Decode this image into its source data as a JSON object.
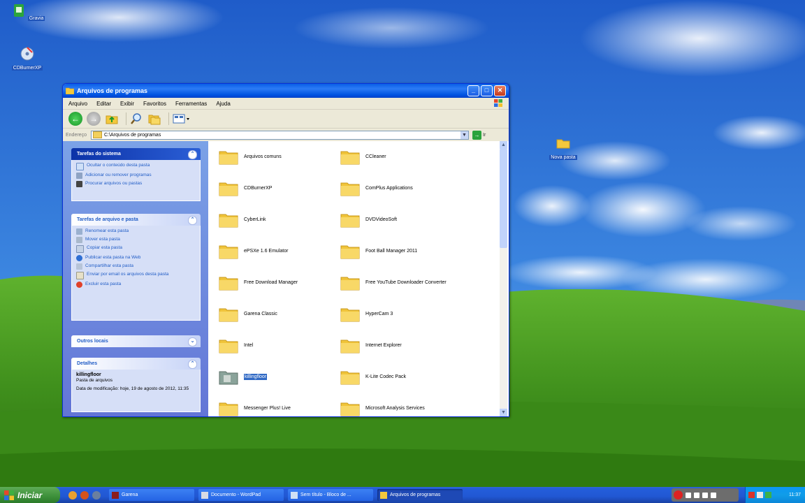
{
  "desktop": {
    "icons": [
      {
        "label": "Gravia",
        "icon": "green-app-icon"
      },
      {
        "label": "CDBurnerXP",
        "icon": "cd-burner-icon"
      },
      {
        "label": "Nova pasta",
        "icon": "folder-icon"
      }
    ]
  },
  "window": {
    "title": "Arquivos de programas",
    "menu": [
      "Arquivo",
      "Editar",
      "Exibir",
      "Favoritos",
      "Ferramentas",
      "Ajuda"
    ],
    "address": {
      "label": "Endereço",
      "value": "C:\\Arquivos de programas",
      "go_label": "Ir"
    },
    "system_tasks": {
      "title": "Tarefas do sistema",
      "items": [
        "Ocultar o conteúdo desta pasta",
        "Adicionar ou remover programas",
        "Procurar arquivos ou pastas"
      ]
    },
    "file_tasks": {
      "title": "Tarefas de arquivo e pasta",
      "items": [
        "Renomear esta pasta",
        "Mover esta pasta",
        "Copiar esta pasta",
        "Publicar esta pasta na Web",
        "Compartilhar esta pasta",
        "Enviar por email os arquivos desta pasta",
        "Excluir esta pasta"
      ]
    },
    "other_places": {
      "title": "Outros locais"
    },
    "details": {
      "title": "Detalhes",
      "name": "killingfloor",
      "type": "Pasta de arquivos",
      "modified": "Data de modificação: hoje, 19 de agosto de 2012, 11:35"
    },
    "folders": [
      "Arquivos comuns",
      "CCleaner",
      "CDBurnerXP",
      "ComPlus Applications",
      "CyberLink",
      "DVDVideoSoft",
      "ePSXe 1.6 Emulator",
      "Foot Ball Manager 2011",
      "Free Download Manager",
      "Free YouTube Downloader Converter",
      "Garena Classic",
      "HyperCam 3",
      "Intel",
      "Internet Explorer",
      "killingfloor",
      "K-Lite Codec Pack",
      "Messenger Plus! Live",
      "Microsoft Analysis Services"
    ],
    "selected_folder": "killingfloor"
  },
  "taskbar": {
    "start_label": "Iniciar",
    "tasks": [
      {
        "label": "Garena",
        "active": false
      },
      {
        "label": "Documento - WordPad",
        "active": false
      },
      {
        "label": "Sem título - Bloco de ...",
        "active": false
      },
      {
        "label": "Arquivos de programas",
        "active": true
      }
    ],
    "clock": "11:37"
  },
  "colors": {
    "xp_blue": "#0053e1",
    "selection": "#316ac5",
    "task_link": "#215dc6",
    "start_green": "#3c8f3a"
  }
}
